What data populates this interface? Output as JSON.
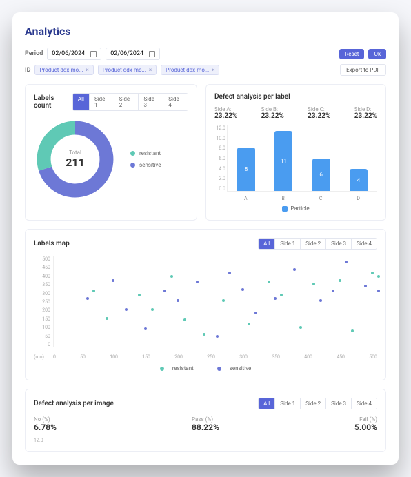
{
  "title": "Analytics",
  "filters": {
    "period_label": "Period",
    "date_from": "02/06/2024",
    "date_to": "02/06/2024",
    "reset_label": "Reset",
    "ok_label": "Ok",
    "id_label": "ID",
    "chips": [
      "Product ddx-mo...",
      "Product ddx-mo...",
      "Product ddx-mo..."
    ],
    "export_label": "Export to PDF"
  },
  "tabs": [
    "All",
    "Side 1",
    "Side 2",
    "Side 3",
    "Side 4"
  ],
  "labels_count": {
    "title": "Labels count",
    "total_label": "Total",
    "total": "211",
    "categories": [
      "resistant",
      "sensitive"
    ],
    "colors": [
      "#5fc9b5",
      "#6d78d6"
    ]
  },
  "defect_label": {
    "title": "Defect analysis per label",
    "sides": [
      {
        "name": "Side A:",
        "value": "23.22%"
      },
      {
        "name": "Side B:",
        "value": "23.22%"
      },
      {
        "name": "Side C:",
        "value": "23.22%"
      },
      {
        "name": "Side D:",
        "value": "23.22%"
      }
    ],
    "legend_label": "Particle"
  },
  "labels_map": {
    "title": "Labels map",
    "xlabel": "(mo)",
    "categories": [
      "resistant",
      "sensitive"
    ],
    "colors": [
      "#5fc9b5",
      "#6d78d6"
    ]
  },
  "defect_image": {
    "title": "Defect analysis per image",
    "stats": [
      {
        "label": "No (%)",
        "value": "6.78%"
      },
      {
        "label": "Pass (%)",
        "value": "88.22%"
      },
      {
        "label": "Fail (%)",
        "value": "5.00%"
      }
    ],
    "axis_tick": "12.0"
  },
  "chart_data": [
    {
      "type": "pie",
      "title": "Labels count",
      "total": 211,
      "series": [
        {
          "name": "resistant",
          "value_pct": 30,
          "color": "#5fc9b5"
        },
        {
          "name": "sensitive",
          "value_pct": 70,
          "color": "#6d78d6"
        }
      ]
    },
    {
      "type": "bar",
      "title": "Defect analysis per label",
      "categories": [
        "A",
        "B",
        "C",
        "D"
      ],
      "series": [
        {
          "name": "Particle",
          "values": [
            8,
            11,
            6,
            4
          ],
          "color": "#4a9cf0"
        }
      ],
      "ylim": [
        0,
        12
      ],
      "yticks": [
        0,
        2.0,
        4.0,
        6.0,
        8.0,
        10.0,
        12.0
      ],
      "xlabel": "",
      "ylabel": ""
    },
    {
      "type": "scatter",
      "title": "Labels map",
      "xlabel": "(mo)",
      "ylabel": "",
      "xlim": [
        0,
        500
      ],
      "ylim": [
        0,
        500
      ],
      "xticks": [
        0,
        50,
        100,
        150,
        200,
        250,
        300,
        350,
        400,
        450,
        500
      ],
      "yticks": [
        0,
        50,
        100,
        150,
        200,
        250,
        300,
        350,
        400,
        450,
        500
      ],
      "series": [
        {
          "name": "resistant",
          "color": "#5fc9b5",
          "points": [
            [
              60,
              300
            ],
            [
              80,
              150
            ],
            [
              130,
              280
            ],
            [
              150,
              200
            ],
            [
              180,
              380
            ],
            [
              200,
              140
            ],
            [
              230,
              60
            ],
            [
              260,
              250
            ],
            [
              300,
              120
            ],
            [
              330,
              350
            ],
            [
              350,
              280
            ],
            [
              380,
              100
            ],
            [
              400,
              340
            ],
            [
              440,
              360
            ],
            [
              460,
              80
            ],
            [
              490,
              400
            ],
            [
              500,
              380
            ]
          ]
        },
        {
          "name": "sensitive",
          "color": "#6d78d6",
          "points": [
            [
              50,
              260
            ],
            [
              90,
              360
            ],
            [
              110,
              200
            ],
            [
              140,
              90
            ],
            [
              170,
              300
            ],
            [
              190,
              250
            ],
            [
              220,
              350
            ],
            [
              250,
              50
            ],
            [
              270,
              400
            ],
            [
              290,
              310
            ],
            [
              310,
              180
            ],
            [
              340,
              260
            ],
            [
              370,
              420
            ],
            [
              410,
              250
            ],
            [
              430,
              300
            ],
            [
              450,
              460
            ],
            [
              480,
              330
            ],
            [
              500,
              300
            ]
          ]
        }
      ]
    }
  ]
}
